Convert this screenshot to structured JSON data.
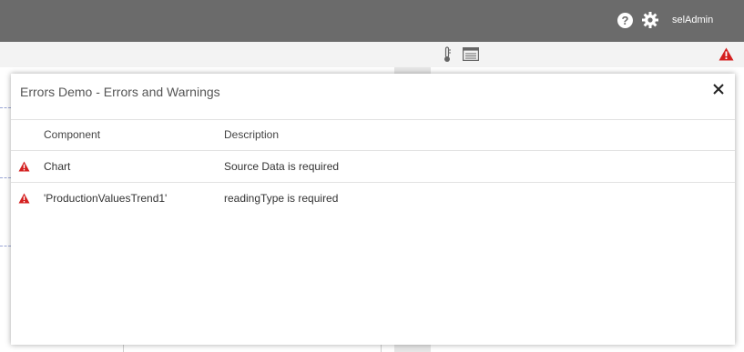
{
  "header": {
    "help_icon_char": "?",
    "user_label": "selAdmin"
  },
  "colors": {
    "topbar": "#6b6b6b",
    "warning": "#d42020"
  },
  "toolbar": {
    "icons": [
      "thermometer-icon",
      "list-view-icon",
      "warning-icon"
    ]
  },
  "dialog": {
    "title": "Errors Demo - Errors and Warnings",
    "columns": {
      "component": "Component",
      "description": "Description"
    },
    "rows": [
      {
        "component": "Chart",
        "description": "Source Data is required",
        "level": "error"
      },
      {
        "component": "'ProductionValuesTrend1'",
        "description": "readingType is required",
        "level": "error"
      }
    ]
  }
}
